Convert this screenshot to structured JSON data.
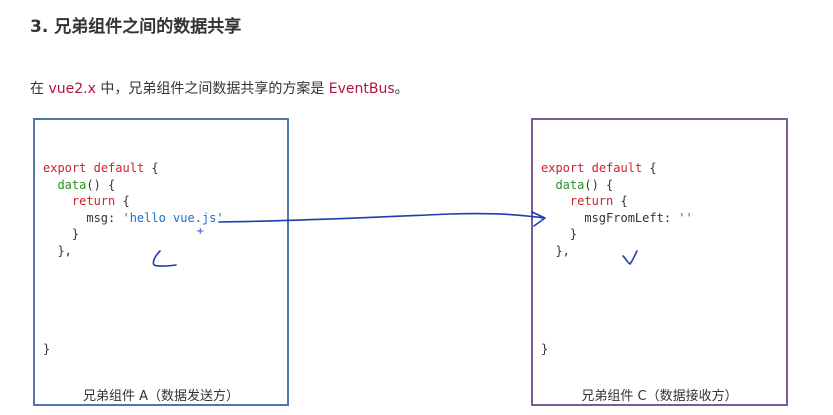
{
  "heading": "3. 兄弟组件之间的数据共享",
  "intro": {
    "before": "在 ",
    "version": "vue2.x",
    "middle": " 中，兄弟组件之间数据共享的方案是 ",
    "solution": "EventBus",
    "after": "。"
  },
  "box_a": {
    "code": {
      "export": "export",
      "default": "default",
      "open_brace": " {",
      "data_fn": "data",
      "data_rest": "() {",
      "return_kw": "return",
      "return_rest": " {",
      "key": "msg: ",
      "value": "'hello vue.js'",
      "inner_close": "}",
      "outer_close": "},",
      "final_close": "}"
    },
    "caption": "兄弟组件 A（数据发送方）"
  },
  "box_c": {
    "code": {
      "export": "export",
      "default": "default",
      "open_brace": " {",
      "data_fn": "data",
      "data_rest": "() {",
      "return_kw": "return",
      "return_rest": " {",
      "key": "msgFromLeft: ",
      "value": "''",
      "inner_close": "}",
      "outer_close": "},",
      "final_close": "}"
    },
    "caption": "兄弟组件 C（数据接收方）"
  },
  "annotation": {
    "plus_mark": "+",
    "ink_color": "#1a3fb0"
  },
  "colors": {
    "keyword": "#c8232c",
    "function": "#2e8b26",
    "string": "#1a6fd0",
    "highlight": "#b5123b",
    "box_a_border": "#4f77aa",
    "box_c_border": "#7b5c97"
  }
}
